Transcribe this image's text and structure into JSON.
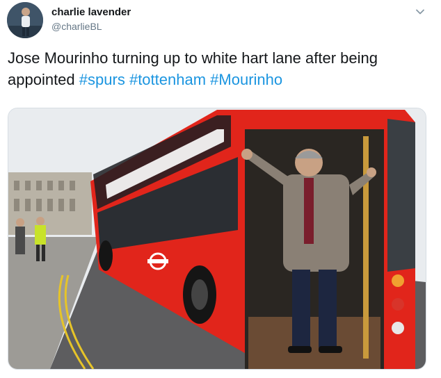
{
  "tweet": {
    "author_name": "charlie lavender",
    "author_handle": "@charlieBL",
    "text_lead": "Jose Mourinho turning up to white hart lane after being appointed",
    "hashtags": [
      "#spurs",
      "#tottenham",
      "#Mourinho"
    ]
  },
  "icons": {
    "menu": "chevron-down-icon",
    "avatar": "avatar"
  },
  "colors": {
    "hashtag": "#1b95e0",
    "handle": "#657786",
    "text": "#14171a",
    "bus_red": "#e1251b"
  }
}
